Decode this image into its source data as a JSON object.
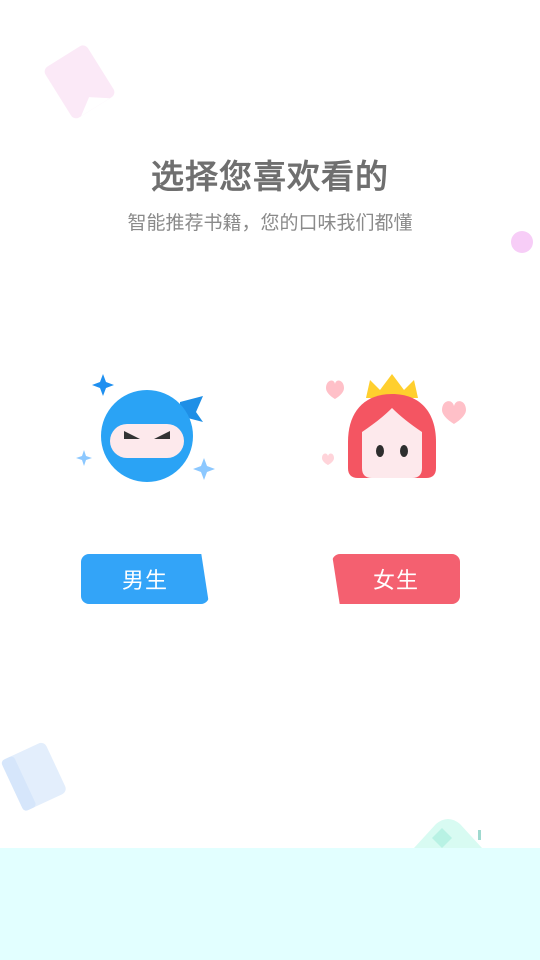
{
  "header": {
    "title": "选择您喜欢看的",
    "subtitle": "智能推荐书籍，您的口味我们都懂"
  },
  "options": {
    "male": {
      "label": "男生",
      "icon": "ninja-boy-icon",
      "color": "#33a4f8"
    },
    "female": {
      "label": "女生",
      "icon": "princess-girl-icon",
      "color": "#f46070"
    }
  },
  "colors": {
    "title": "#6f6f6f",
    "subtitle": "#8a8a8a",
    "bottom_band": "#e2ffff"
  }
}
